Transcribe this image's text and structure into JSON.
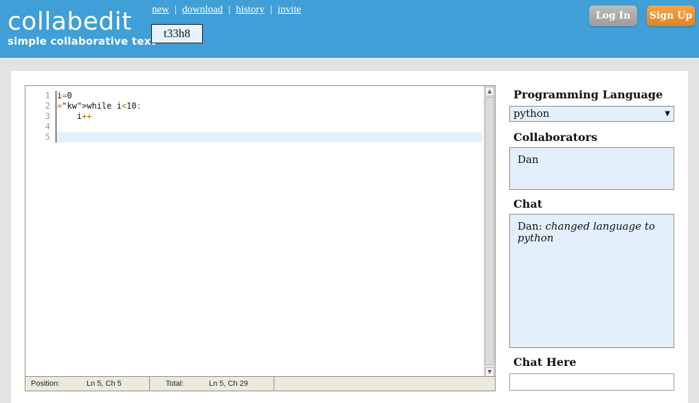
{
  "header": {
    "logo": "collabedit",
    "tagline": "simple collaborative text",
    "nav": [
      "new",
      "download",
      "history",
      "invite"
    ],
    "doc_id": "t33h8",
    "login_label": "Log In",
    "signup_label": "Sign Up"
  },
  "editor": {
    "line_numbers": [
      "1",
      "2",
      "3",
      "4",
      "5"
    ],
    "lines": [
      "i=0",
      "while i<10:",
      "    i++",
      "",
      ""
    ],
    "active_line": 5,
    "status": {
      "position_label": "Position:",
      "position_value": "Ln 5, Ch 5",
      "total_label": "Total:",
      "total_value": "Ln 5, Ch 29"
    }
  },
  "sidebar": {
    "language_title": "Programming Language",
    "language_selected": "python",
    "collaborators_title": "Collaborators",
    "collaborators": [
      "Dan"
    ],
    "chat_title": "Chat",
    "chat_messages": [
      {
        "user": "Dan:",
        "text": "changed language to python"
      }
    ],
    "chat_input_title": "Chat Here",
    "chat_input_value": ""
  },
  "colors": {
    "header": "#3f9fd6",
    "signup": "#e08420",
    "login": "#9c9c9c",
    "box_bg": "#e3f0fb"
  }
}
